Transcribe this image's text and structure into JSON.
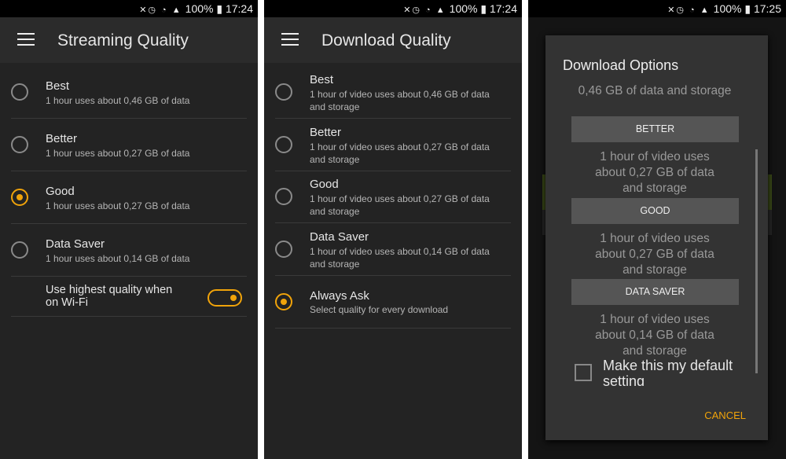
{
  "status": [
    {
      "battery": "100%",
      "time": "17:24"
    },
    {
      "battery": "100%",
      "time": "17:24"
    },
    {
      "battery": "100%",
      "time": "17:25"
    }
  ],
  "streaming": {
    "title": "Streaming Quality",
    "options": [
      {
        "label": "Best",
        "desc": "1 hour uses about 0,46 GB of data",
        "selected": false
      },
      {
        "label": "Better",
        "desc": "1 hour uses about 0,27 GB of data",
        "selected": false
      },
      {
        "label": "Good",
        "desc": "1 hour uses about 0,27 GB of data",
        "selected": true
      },
      {
        "label": "Data Saver",
        "desc": "1 hour uses about 0,14 GB of data",
        "selected": false
      }
    ],
    "wifi_toggle": {
      "label": "Use highest quality when on Wi-Fi",
      "on": true
    }
  },
  "download": {
    "title": "Download Quality",
    "options": [
      {
        "label": "Best",
        "desc": "1 hour of video uses about 0,46 GB of data and storage",
        "selected": false
      },
      {
        "label": "Better",
        "desc": "1 hour of video uses about 0,27 GB of data and storage",
        "selected": false
      },
      {
        "label": "Good",
        "desc": "1 hour of video uses about 0,27 GB of data and storage",
        "selected": false
      },
      {
        "label": "Data Saver",
        "desc": "1 hour of video uses about 0,14 GB of data and storage",
        "selected": false
      },
      {
        "label": "Always Ask",
        "desc": "Select quality for every download",
        "selected": true
      }
    ]
  },
  "dialog": {
    "title": "Download Options",
    "top_text": "0,46 GB of data and storage",
    "options": [
      {
        "button": "BETTER",
        "desc": "1 hour of video uses about 0,27 GB of data and storage"
      },
      {
        "button": "GOOD",
        "desc": "1 hour of video uses about 0,27 GB of data and storage"
      },
      {
        "button": "DATA SAVER",
        "desc": "1 hour of video uses about 0,14 GB of data and storage"
      }
    ],
    "default_checkbox": "Make this my default setting",
    "cancel": "CANCEL"
  },
  "colors": {
    "accent": "#f0a30a",
    "background": "#232323"
  }
}
